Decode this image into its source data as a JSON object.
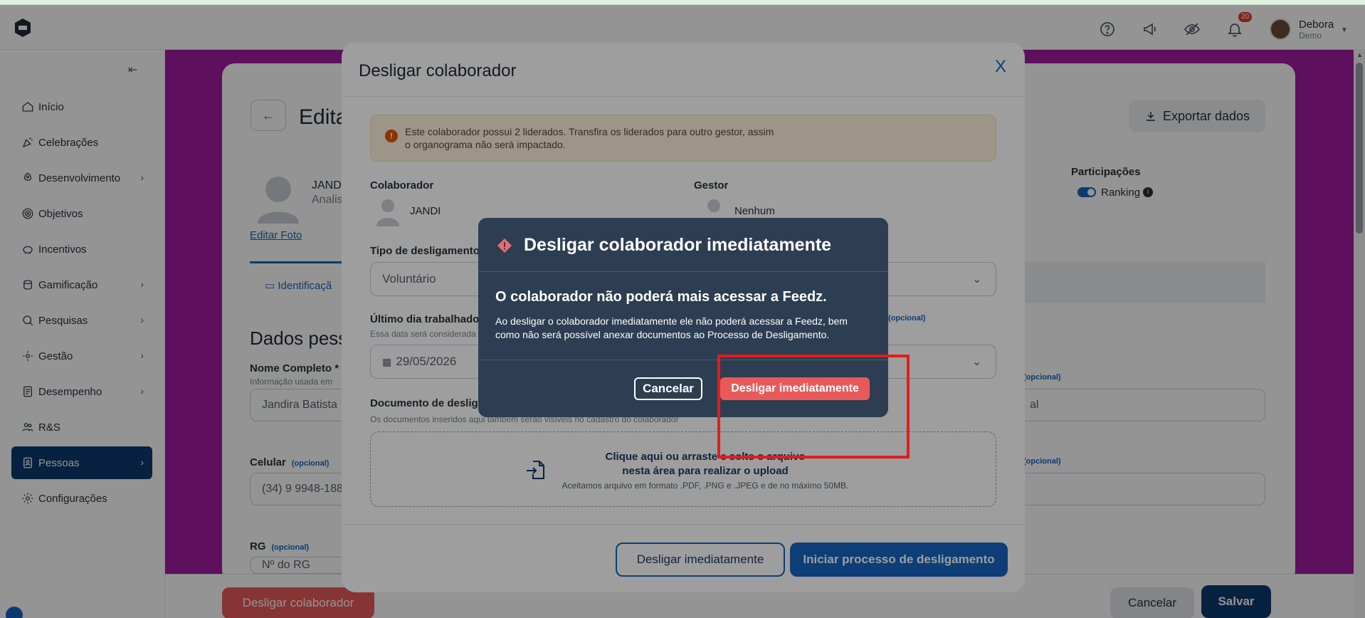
{
  "topbar": {
    "user_name": "Debora",
    "user_sub": "Demo",
    "notification_count": "20",
    "icons": [
      "help-circle-icon",
      "megaphone-icon",
      "eye-off-icon",
      "bell-icon"
    ]
  },
  "sidebar": {
    "items": [
      {
        "label": "Início",
        "icon": "home-icon",
        "chevron": false
      },
      {
        "label": "Celebrações",
        "icon": "party-icon",
        "chevron": false
      },
      {
        "label": "Desenvolvimento",
        "icon": "rocket-icon",
        "chevron": true
      },
      {
        "label": "Objetivos",
        "icon": "target-icon",
        "chevron": false
      },
      {
        "label": "Incentivos",
        "icon": "piggy-bank-icon",
        "chevron": false
      },
      {
        "label": "Gamificação",
        "icon": "coins-icon",
        "chevron": true
      },
      {
        "label": "Pesquisas",
        "icon": "search-doc-icon",
        "chevron": true
      },
      {
        "label": "Gestão",
        "icon": "gear-people-icon",
        "chevron": true
      },
      {
        "label": "Desempenho",
        "icon": "chart-doc-icon",
        "chevron": true
      },
      {
        "label": "R&S",
        "icon": "people-icon",
        "chevron": false
      },
      {
        "label": "Pessoas",
        "icon": "badge-icon",
        "chevron": true,
        "active": true
      },
      {
        "label": "Configurações",
        "icon": "gear-icon",
        "chevron": false
      }
    ]
  },
  "page": {
    "title": "Edita",
    "export_label": "Exportar dados",
    "profile_name": "JAND",
    "profile_role": "Analis",
    "edit_photo": "Editar Foto",
    "participations_label": "Participações",
    "ranking_label": "Ranking",
    "tab_identification": "Identificaçã",
    "section_title": "Dados pess",
    "full_name_label": "Nome Completo",
    "full_name_required": "*",
    "full_name_hint": "Informação usada em",
    "full_name_value": "Jandira Batista",
    "phone_label": "Celular",
    "optional": "(opcional)",
    "phone_value": "(34) 9 9948-188",
    "rg_label": "RG",
    "rg_placeholder": "Nº do RG",
    "right_field_value": "al",
    "footer_desligar": "Desligar colaborador",
    "footer_cancel": "Cancelar",
    "footer_save": "Salvar"
  },
  "modal_main": {
    "title": "Desligar colaborador",
    "close": "X",
    "warning_line1": "Este colaborador possui 2 liderados. Transfira os liderados para outro gestor, assim",
    "warning_line2": "o organograma não será impactado.",
    "collaborator_label": "Colaborador",
    "collaborator_value": "JANDI",
    "manager_label": "Gestor",
    "manager_value": "Nenhum",
    "type_label": "Tipo de desligamento",
    "type_value": "Voluntário",
    "last_day_label": "Último dia trabalhado",
    "last_day_hint": "Essa data será considerada",
    "last_day_value": "29/05/2026",
    "right_optional": "(opcional)",
    "document_label": "Documento de desliga",
    "document_hint": "Os documentos inseridos aqui também serão visíveis no cadastro do colaborador",
    "upload_line1": "Clique aqui ou arraste e solte o arquivo",
    "upload_line2": "nesta área para realizar o upload",
    "upload_line3": "Aceitamos arquivo em formato .PDF, .PNG e .JPEG e de no máximo 50MB.",
    "btn_immediate": "Desligar imediatamente",
    "btn_start_process": "Iniciar processo de desligamento"
  },
  "modal_confirm": {
    "title": "Desligar colaborador imediatamente",
    "heading": "O colaborador não poderá mais acessar a Feedz.",
    "body": "Ao desligar o colaborador imediatamente ele não poderá acessar a Feedz, bem como não será possível anexar documentos ao Processo de Desligamento.",
    "cancel": "Cancelar",
    "confirm": "Desligar imediatamente"
  },
  "colors": {
    "primary": "#1565c0",
    "navy": "#0d3b6e",
    "danger": "#e85a5a",
    "modal_dark": "#2d3e52",
    "magenta_bg": "#a31aa3",
    "highlight": "#e21d1d"
  }
}
